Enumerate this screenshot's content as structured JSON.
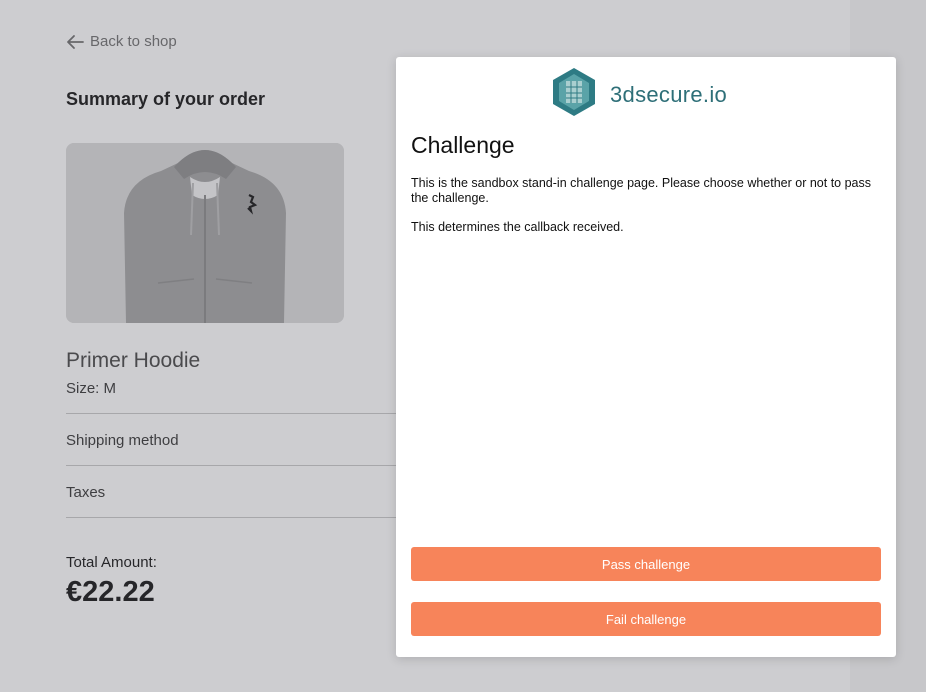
{
  "shop": {
    "back_label": "Back to shop",
    "summary_title": "Summary of your order",
    "product": {
      "name": "Primer Hoodie",
      "size": "Size: M",
      "image_alt_icon": "hoodie-image"
    },
    "rows": [
      {
        "label": "Shipping method"
      },
      {
        "label": "Taxes"
      }
    ],
    "total_label": "Total Amount:",
    "total_amount": "€22.22"
  },
  "modal": {
    "brand_name": "3dsecure.io",
    "title": "Challenge",
    "paragraphs": [
      "This is the sandbox stand-in challenge page. Please choose whether or not to pass the challenge.",
      "This determines the callback received."
    ],
    "buttons": {
      "pass_label": "Pass challenge",
      "fail_label": "Fail challenge"
    }
  },
  "colors": {
    "accent_button": "#f7845a",
    "brand_teal": "#2e6f78",
    "overlay": "rgba(90,90,100,0.30)"
  }
}
